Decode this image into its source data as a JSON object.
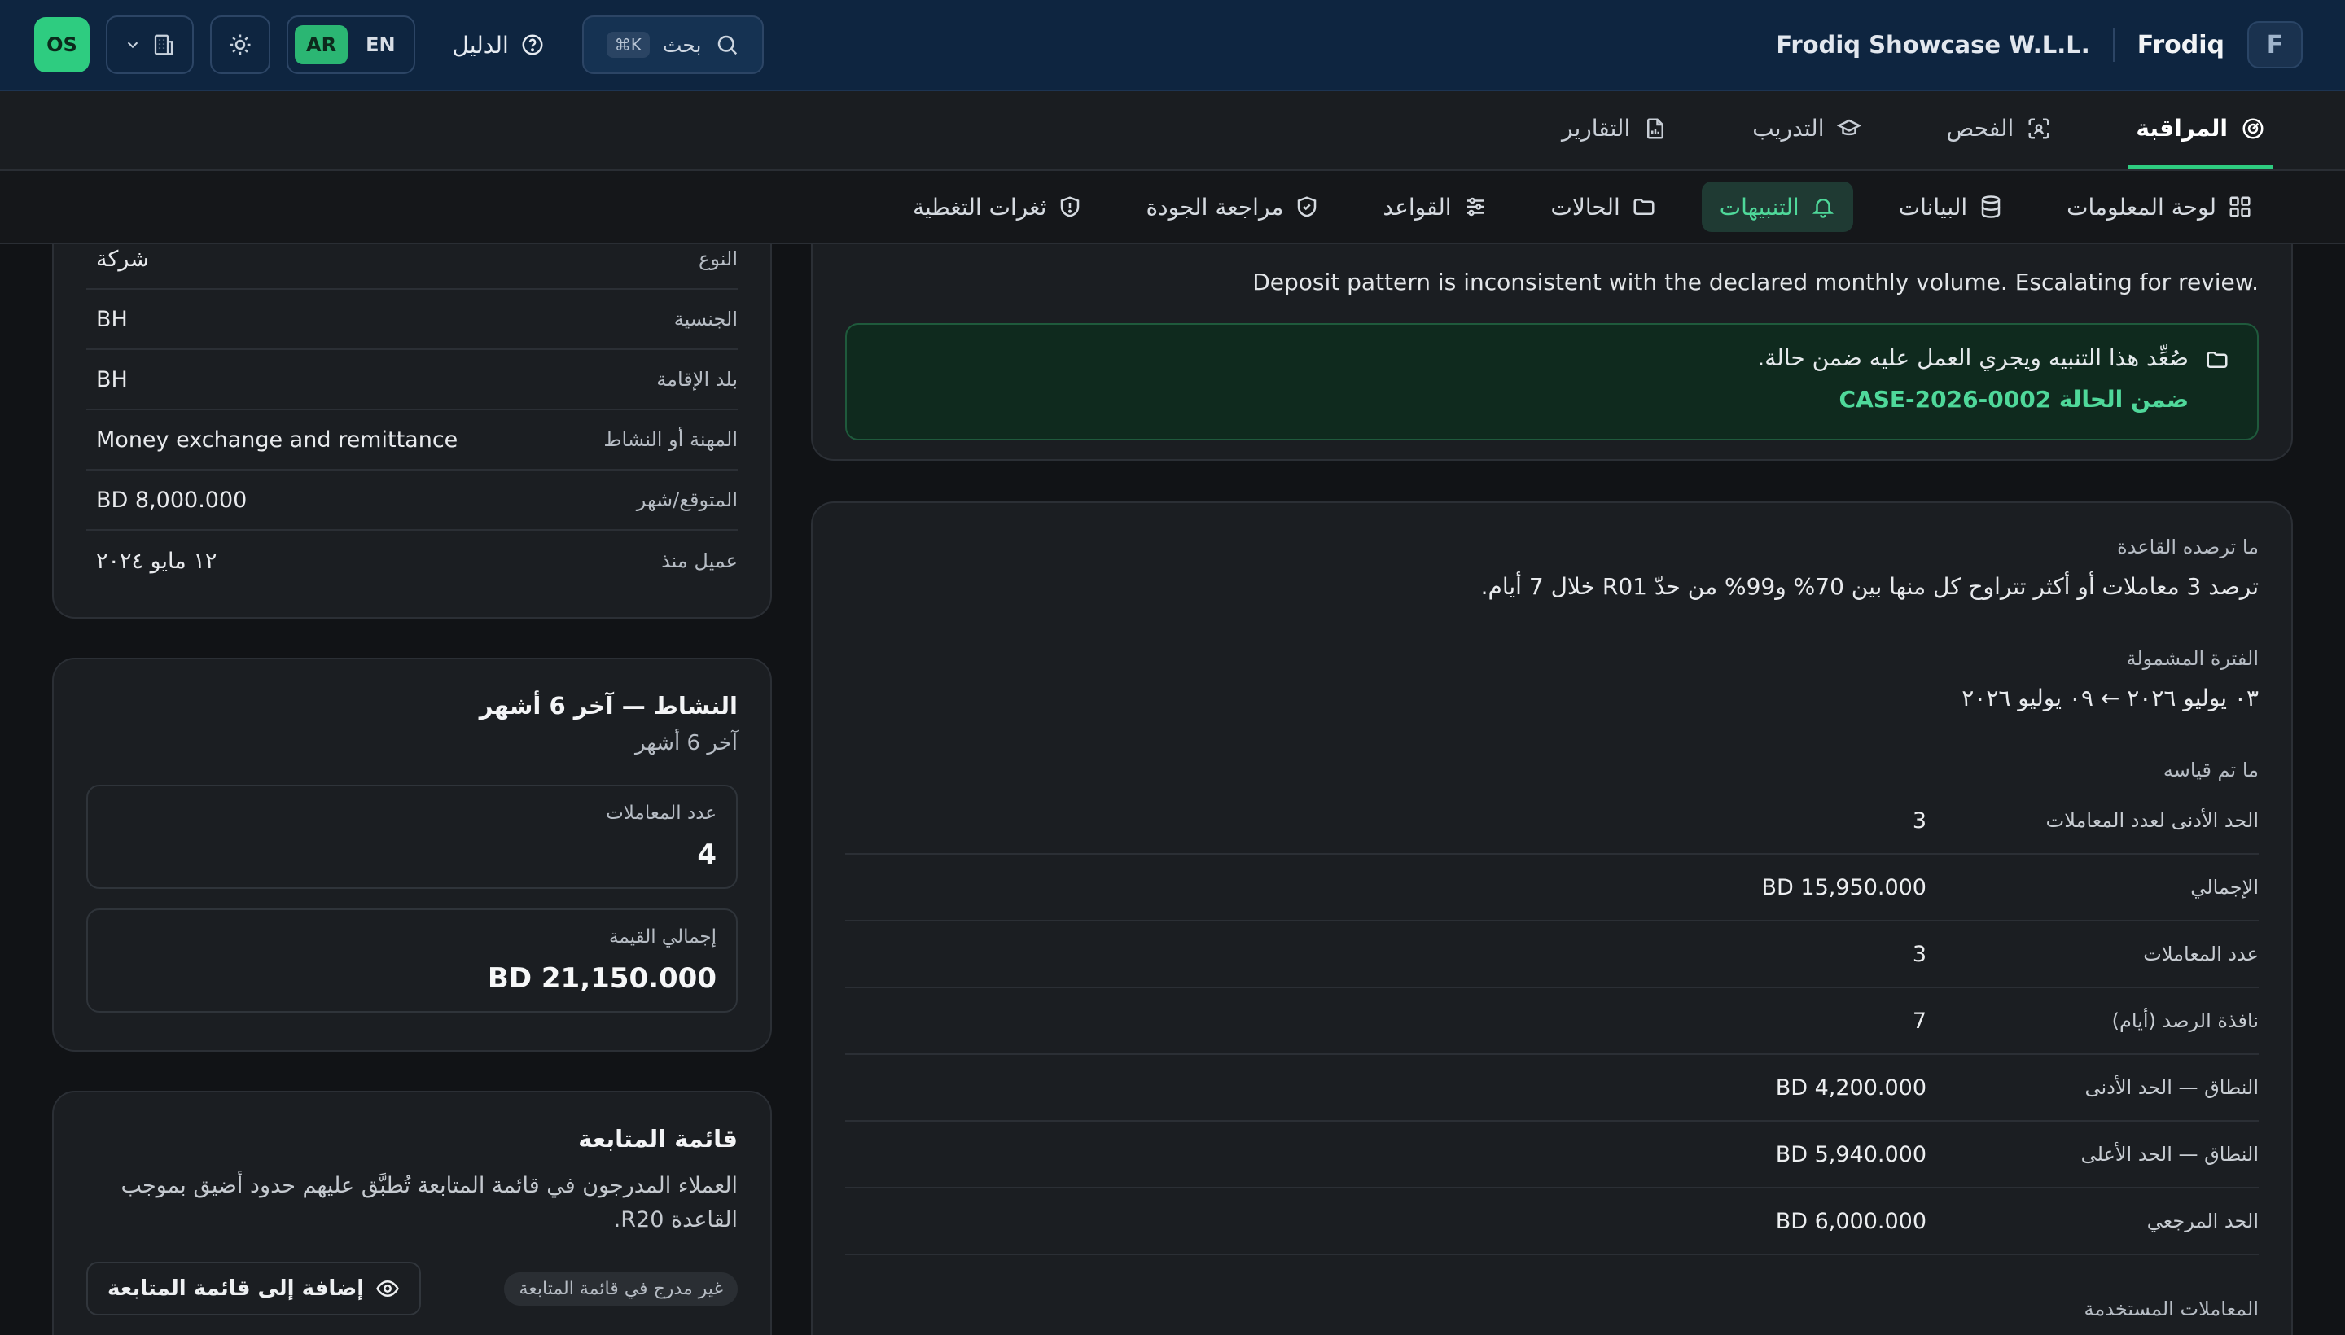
{
  "header": {
    "brand": "Frodiq",
    "brand_logo": "F",
    "org": "Frodiq Showcase W.L.L.",
    "search_label": "بحث",
    "search_shortcut": "⌘K",
    "guide": "الدليل",
    "lang_ar": "AR",
    "lang_en": "EN",
    "avatar": "OS"
  },
  "main_nav": [
    {
      "label": "المراقبة",
      "icon": "monitor-gauge-icon",
      "active": true
    },
    {
      "label": "الفحص",
      "icon": "scan-icon",
      "active": false
    },
    {
      "label": "التدريب",
      "icon": "graduation-cap-icon",
      "active": false
    },
    {
      "label": "التقارير",
      "icon": "report-file-icon",
      "active": false
    }
  ],
  "sub_nav": [
    {
      "label": "لوحة المعلومات",
      "icon": "dashboard-grid-icon",
      "active": false
    },
    {
      "label": "البيانات",
      "icon": "database-icon",
      "active": false
    },
    {
      "label": "التنبيهات",
      "icon": "bell-icon",
      "active": true
    },
    {
      "label": "الحالات",
      "icon": "folder-icon",
      "active": false
    },
    {
      "label": "القواعد",
      "icon": "sliders-icon",
      "active": false
    },
    {
      "label": "مراجعة الجودة",
      "icon": "shield-check-icon",
      "active": false
    },
    {
      "label": "ثغرات التغطية",
      "icon": "shield-alert-icon",
      "active": false
    }
  ],
  "profile": {
    "rows": [
      {
        "key": "النوع",
        "value": "شركة"
      },
      {
        "key": "الجنسية",
        "value": "BH"
      },
      {
        "key": "بلد الإقامة",
        "value": "BH"
      },
      {
        "key": "المهنة أو النشاط",
        "value": "Money exchange and remittance"
      },
      {
        "key": "المتوقع/شهر",
        "value": "BD 8,000.000"
      },
      {
        "key": "عميل منذ",
        "value": "١٢ مايو ٢٠٢٤"
      }
    ]
  },
  "activity": {
    "title": "النشاط — آخر 6 أشهر",
    "subtitle": "آخر 6 أشهر",
    "tx_count_label": "عدد المعاملات",
    "tx_count": "4",
    "total_label": "إجمالي القيمة",
    "total": "BD 21,150.000"
  },
  "watchlist": {
    "title": "قائمة المتابعة",
    "description": "العملاء المدرجون في قائمة المتابعة تُطبَّق عليهم حدود أضيق بموجب القاعدة R20.",
    "status": "غير مدرج في قائمة المتابعة",
    "add_button": "إضافة إلى قائمة المتابعة"
  },
  "alert": {
    "note": "Deposit pattern is inconsistent with the declared monthly volume. Escalating for review.",
    "case_text": "صُعِّد هذا التنبيه ويجري العمل عليه ضمن حالة.",
    "case_link_prefix": "ضمن الحالة",
    "case_id": "CASE-2026-0002"
  },
  "rule": {
    "watch_label": "ما ترصده القاعدة",
    "watch_text": "ترصد 3 معاملات أو أكثر تتراوح كل منها بين 70% و99% من حدّ R01 خلال 7 أيام.",
    "period_label": "الفترة المشمولة",
    "period_text": "٠٣ يوليو ٢٠٢٦ ← ٠٩ يوليو ٢٠٢٦",
    "measured_label": "ما تم قياسه",
    "metrics": [
      {
        "key": "الحد الأدنى لعدد المعاملات",
        "value": "3"
      },
      {
        "key": "الإجمالي",
        "value": "BD 15,950.000"
      },
      {
        "key": "عدد المعاملات",
        "value": "3"
      },
      {
        "key": "نافذة الرصد (أيام)",
        "value": "7"
      },
      {
        "key": "النطاق — الحد الأدنى",
        "value": "BD 4,200.000"
      },
      {
        "key": "النطاق — الحد الأعلى",
        "value": "BD 5,940.000"
      },
      {
        "key": "الحد المرجعي",
        "value": "BD 6,000.000"
      }
    ],
    "used_label": "المعاملات المستخدمة"
  },
  "colors": {
    "accent": "#2ecc80",
    "header_bg": "#0e2540",
    "page_bg": "#111316",
    "card_bg": "#1b1e22"
  }
}
